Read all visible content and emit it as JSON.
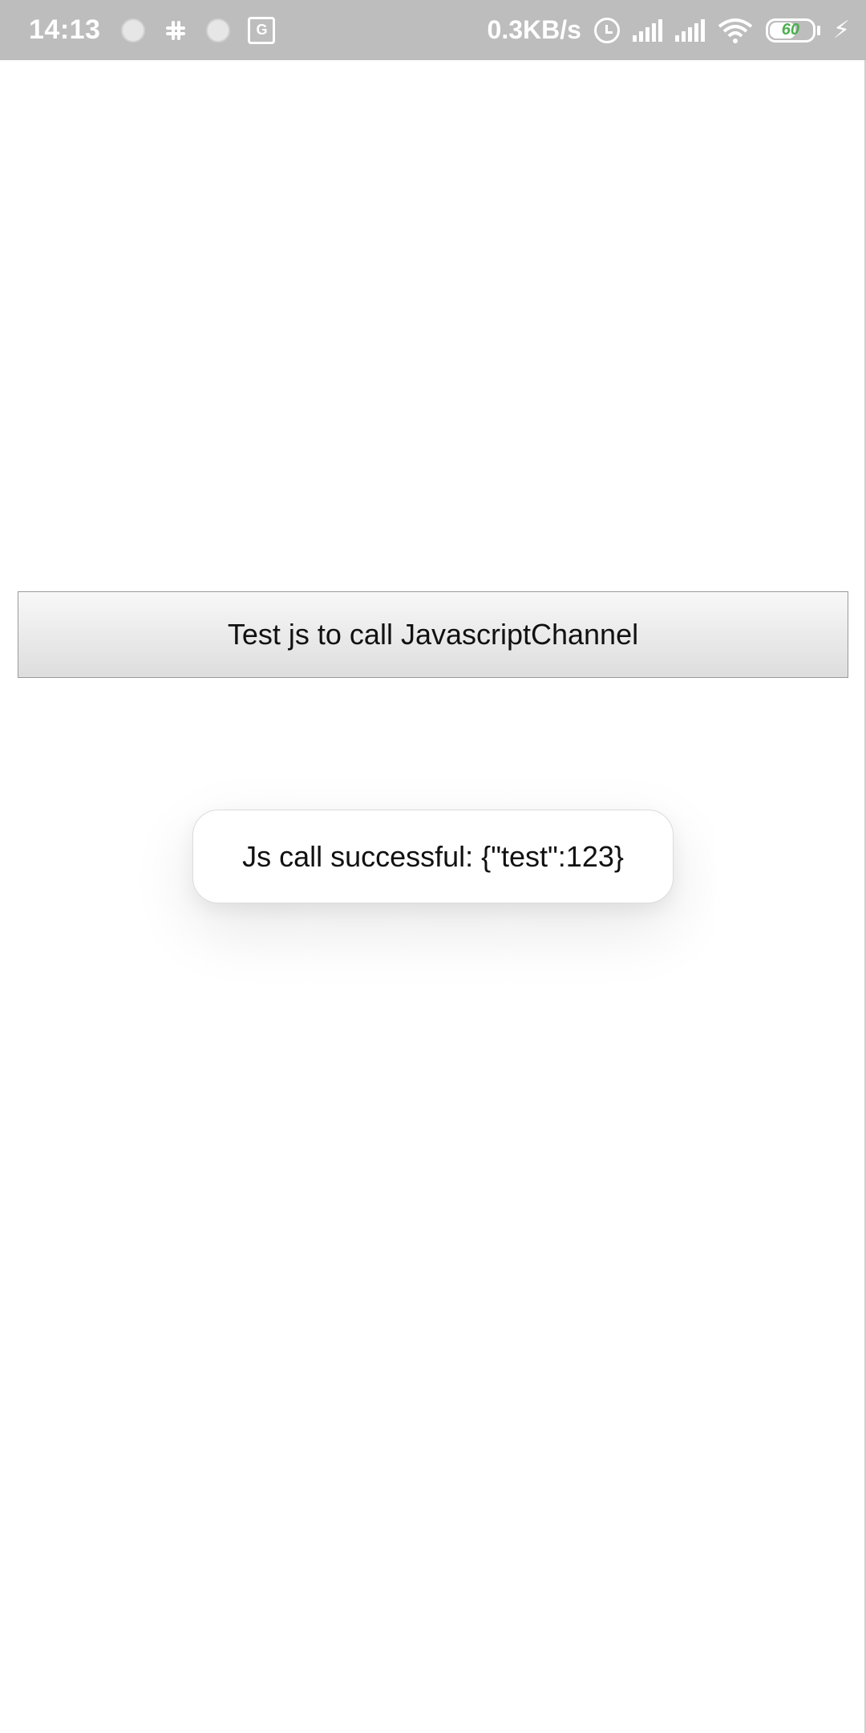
{
  "status_bar": {
    "time": "14:13",
    "net_speed": "0.3KB/s",
    "translate_glyph": "G",
    "battery_level": "60",
    "battery_fraction": 0.6,
    "charging_glyph": "⚡",
    "icons": [
      "notification-dot-icon",
      "slack-icon",
      "notification-dot-icon",
      "translate-icon",
      "alarm-icon",
      "signal-icon",
      "signal-icon",
      "wifi-icon",
      "battery-icon",
      "charging-icon"
    ]
  },
  "main": {
    "button_label": "Test js to call JavascriptChannel"
  },
  "toast": {
    "message": "Js call successful: {\"test\":123}"
  }
}
